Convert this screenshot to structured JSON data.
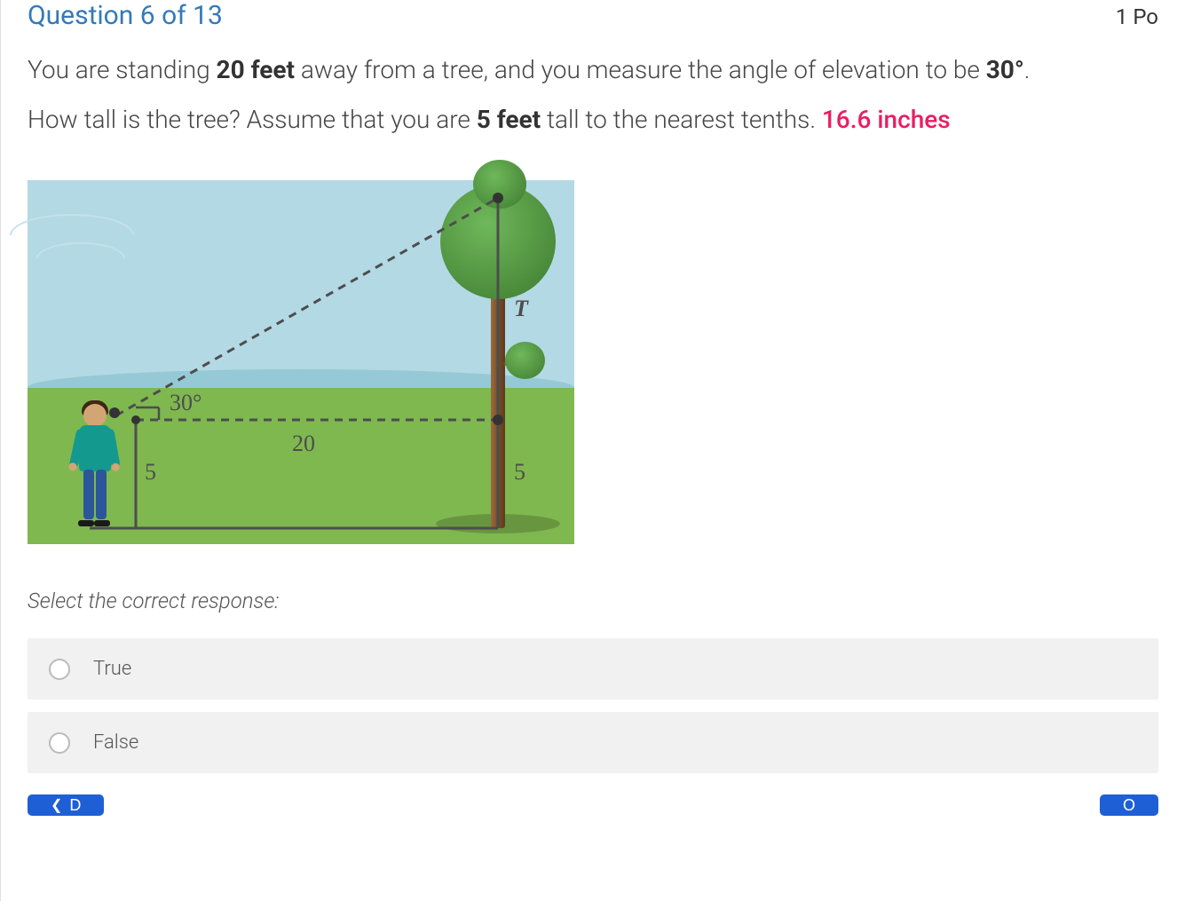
{
  "header": {
    "question_label": "Question 6 of 13",
    "points_label": "1 Po"
  },
  "question": {
    "line1_part1": "You are standing ",
    "line1_bold1": "20 feet",
    "line1_part2": " away from a tree, and you measure the angle of elevation to be ",
    "line1_bold2": "30°",
    "line1_part3": ".",
    "line2_part1": "How tall is the tree? Assume that you are ",
    "line2_bold1": "5 feet",
    "line2_part2": " tall to the nearest tenths.  ",
    "answer_highlight": "16.6 inches"
  },
  "diagram": {
    "angle_label": "30°",
    "horizontal_label": "20",
    "person_height_label": "5",
    "tree_lower_label": "5",
    "tree_upper_label": "T"
  },
  "prompt": "Select the correct response:",
  "options": {
    "opt1": "True",
    "opt2": "False"
  },
  "nav": {
    "prev_partial": "D",
    "next_partial": "O"
  }
}
